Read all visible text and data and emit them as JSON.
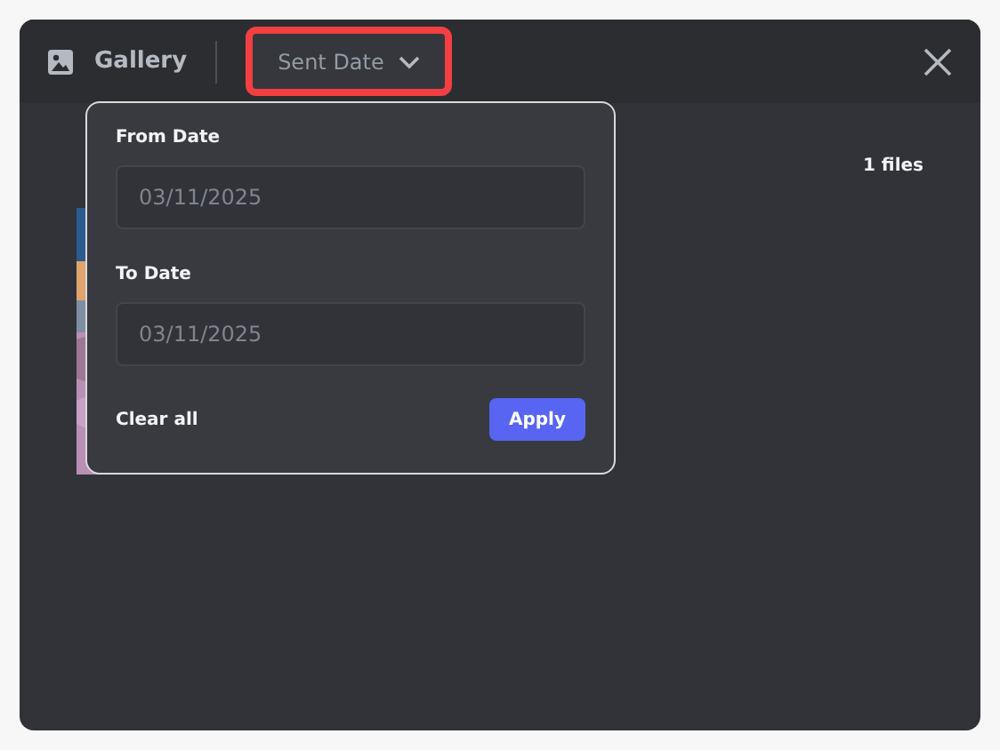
{
  "window": {
    "title": "Gallery"
  },
  "filter": {
    "label": "Sent Date",
    "highlighted": true
  },
  "content": {
    "count": "1 files"
  },
  "date_popup": {
    "fields": [
      {
        "label": "From Date",
        "placeholder": "03/11/2025"
      },
      {
        "label": "To Date",
        "placeholder": "03/11/2025"
      }
    ],
    "clear": "Clear all",
    "apply": "Apply"
  }
}
